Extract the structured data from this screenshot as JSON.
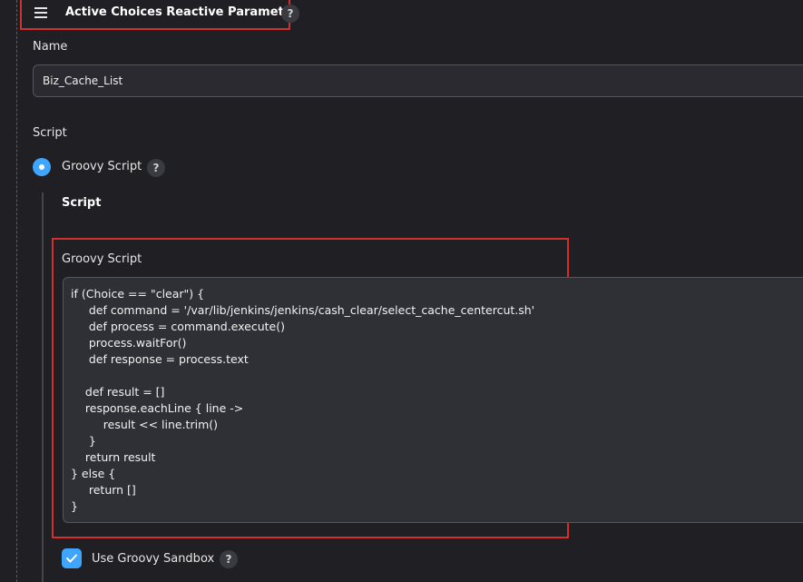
{
  "header": {
    "title": "Active Choices Reactive Parameter",
    "help": "?"
  },
  "name_field": {
    "label": "Name",
    "value": "Biz_Cache_List"
  },
  "script_section": {
    "label": "Script",
    "radio_label": "Groovy Script",
    "radio_selected": true,
    "help": "?",
    "sub_heading": "Script",
    "editor_label": "Groovy Script",
    "code": "if (Choice == \"clear\") {\n     def command = '/var/lib/jenkins/jenkins/cash_clear/select_cache_centercut.sh'\n     def process = command.execute()\n     process.waitFor()\n     def response = process.text\n\n    def result = []\n    response.eachLine { line ->\n         result << line.trim()\n     }\n    return result\n} else {\n     return []\n}",
    "sandbox_label": "Use Groovy Sandbox",
    "sandbox_checked": true,
    "sandbox_help": "?"
  },
  "colors": {
    "background": "#1f1f24",
    "accent": "#3ea6ff",
    "highlight_border": "#d32f2f"
  },
  "icons": {
    "drag_handle": "drag-handle-icon",
    "help": "help-icon",
    "check": "check-icon"
  }
}
